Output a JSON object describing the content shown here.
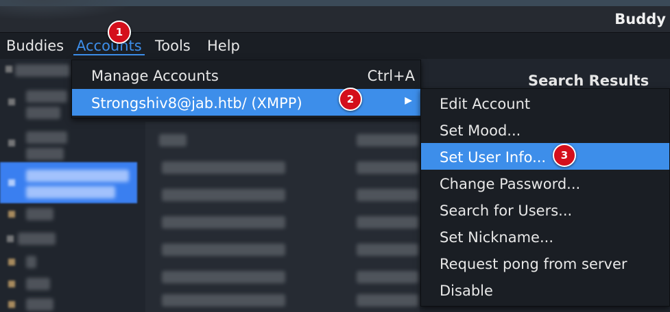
{
  "window": {
    "title": "Buddy"
  },
  "menubar": {
    "items": [
      "Buddies",
      "Accounts",
      "Tools",
      "Help"
    ]
  },
  "accounts_menu": {
    "manage_label": "Manage Accounts",
    "manage_shortcut": "Ctrl+A",
    "account_label": "Strongshiv8@jab.htb/ (XMPP)"
  },
  "account_submenu": {
    "items": [
      "Edit Account",
      "Set Mood...",
      "Set User Info...",
      "Change Password...",
      "Search for Users...",
      "Set Nickname...",
      "Request pong from server",
      "Disable"
    ]
  },
  "results": {
    "title": "Search Results"
  },
  "badges": [
    "1",
    "2",
    "3"
  ],
  "colors": {
    "accent": "#3d8eea",
    "badge": "#d40f1b"
  }
}
